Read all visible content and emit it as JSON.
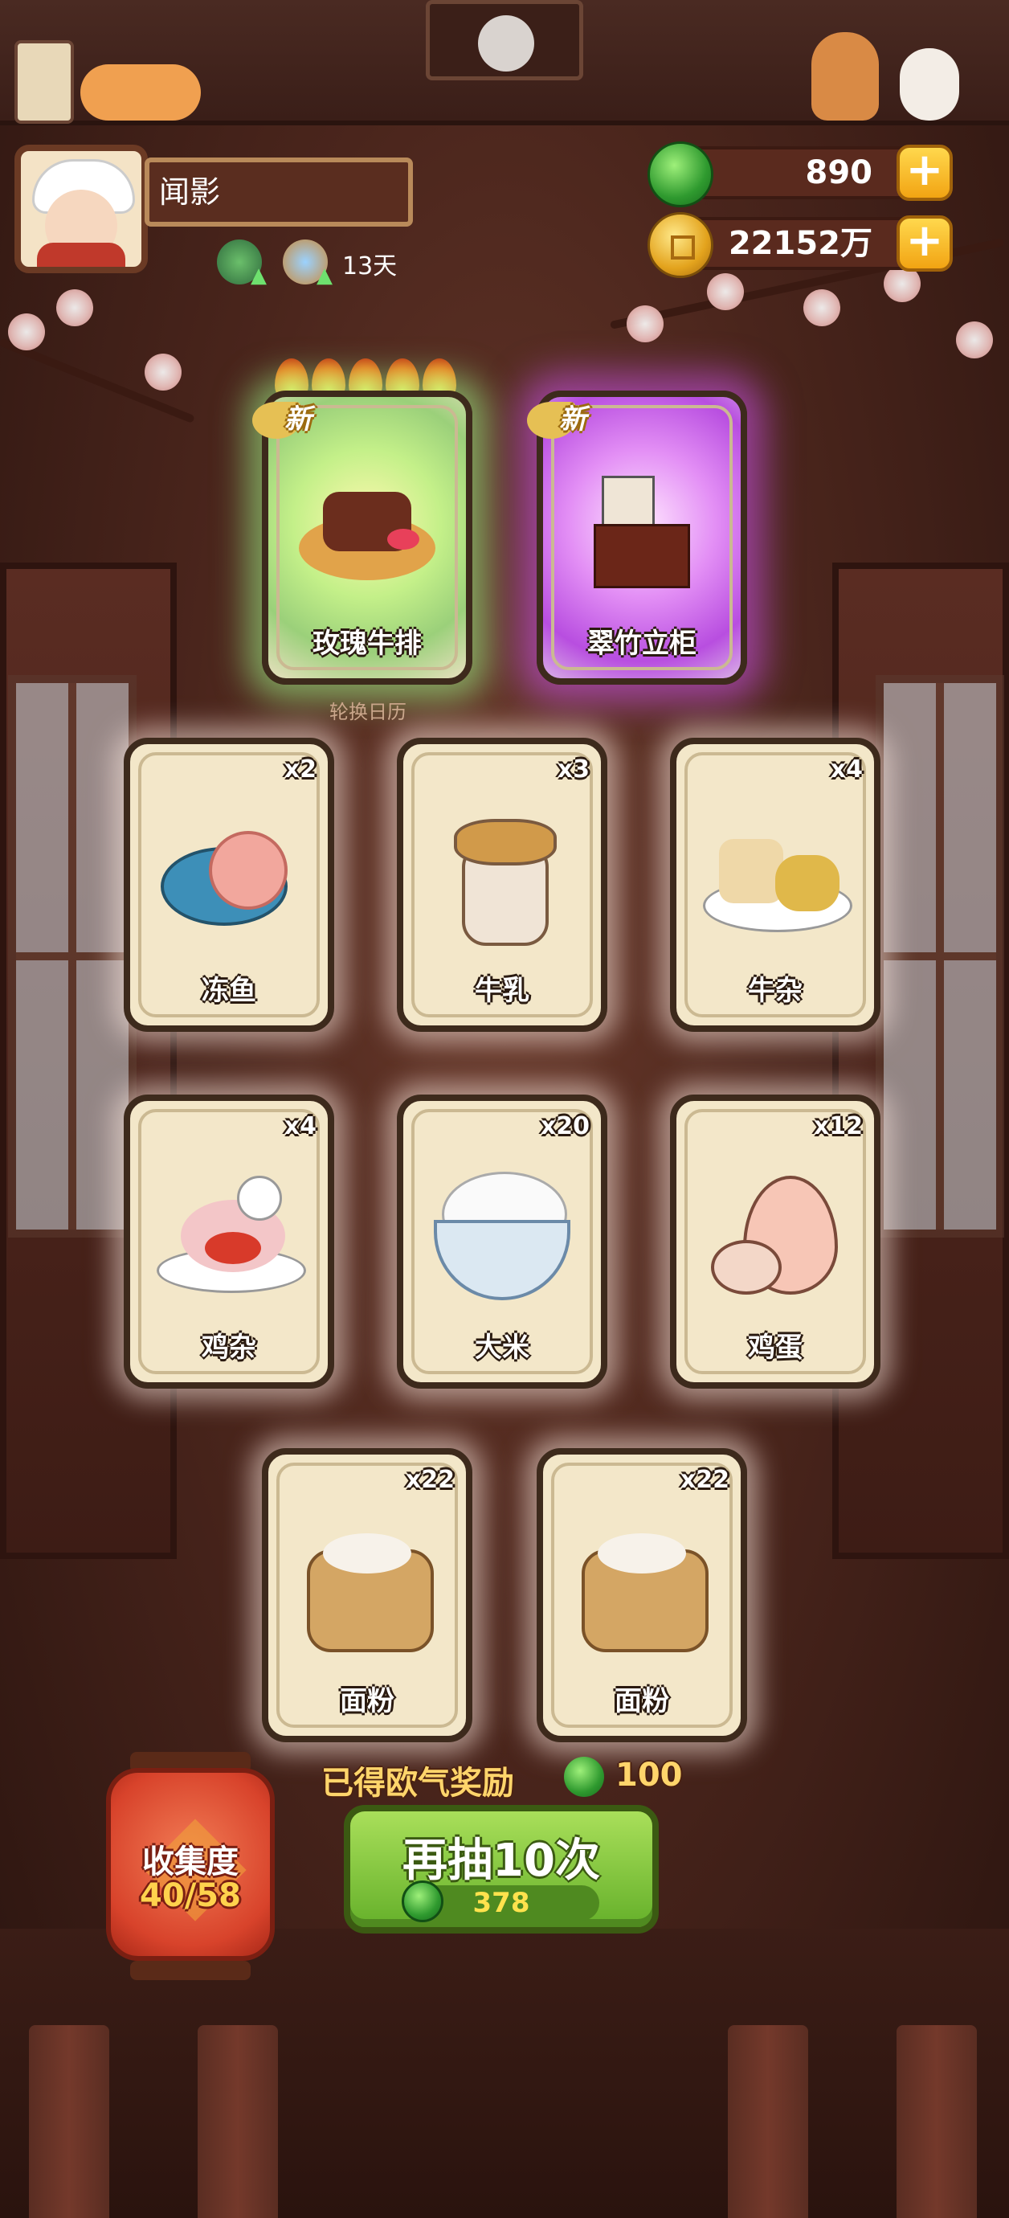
{
  "player": {
    "name": "闻影",
    "buff_days": "13天"
  },
  "currency": {
    "jade": "890",
    "gold": "22152万"
  },
  "featured": [
    {
      "name": "玫瑰牛排",
      "badge": "新",
      "rarity": "green",
      "icon": "steak-icon"
    },
    {
      "name": "翠竹立柜",
      "badge": "新",
      "rarity": "purple",
      "icon": "cabinet-icon"
    }
  ],
  "calendar_label": "轮换日历",
  "items": [
    {
      "name": "冻鱼",
      "qty": "x2",
      "icon": "frozen-fish-icon"
    },
    {
      "name": "牛乳",
      "qty": "x3",
      "icon": "milk-jar-icon"
    },
    {
      "name": "牛杂",
      "qty": "x4",
      "icon": "beef-offal-icon"
    },
    {
      "name": "鸡杂",
      "qty": "x4",
      "icon": "chicken-offal-icon"
    },
    {
      "name": "大米",
      "qty": "x20",
      "icon": "rice-bowl-icon"
    },
    {
      "name": "鸡蛋",
      "qty": "x12",
      "icon": "egg-icon"
    },
    {
      "name": "面粉",
      "qty": "x22",
      "icon": "flour-sack-icon"
    },
    {
      "name": "面粉",
      "qty": "x22",
      "icon": "flour-sack-icon"
    }
  ],
  "reward": {
    "label": "已得欧气奖励",
    "value": "100"
  },
  "draw_button": {
    "label": "再抽10次",
    "cost": "378"
  },
  "collection": {
    "title": "收集度",
    "progress": "40/58"
  }
}
